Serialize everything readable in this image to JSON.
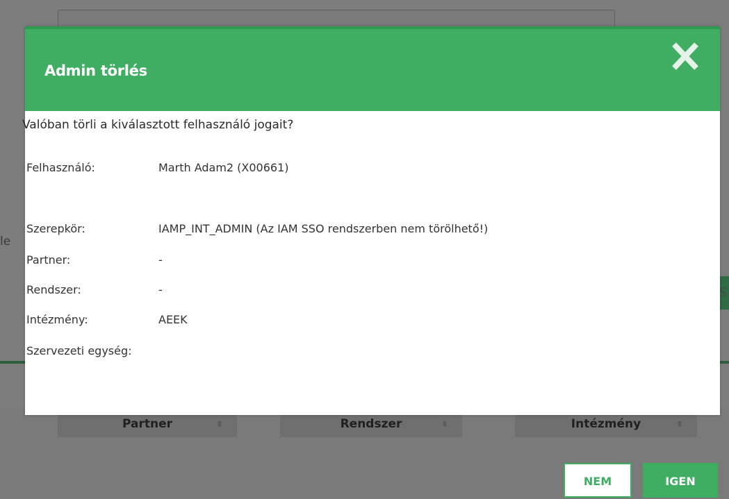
{
  "background": {
    "left_text": "le",
    "right_button_text": "S",
    "table_columns": [
      "Partner",
      "Rendszer",
      "Intézmény"
    ]
  },
  "modal": {
    "title": "Admin törlés",
    "question": "Valóban törli a kiválasztott felhasználó jogait?",
    "fields": [
      {
        "label": "Felhasználó:",
        "value": "Marth Adam2 (X00661)"
      },
      {
        "label": "Szerepkör:",
        "value": "IAMP_INT_ADMIN (Az IAM SSO rendszerben nem törölhető!)"
      },
      {
        "label": "Partner:",
        "value": "-"
      },
      {
        "label": "Rendszer:",
        "value": "-"
      },
      {
        "label": "Intézmény:",
        "value": "AEEK"
      },
      {
        "label": "Szervezeti egység:",
        "value": ""
      }
    ],
    "buttons": {
      "no": "NEM",
      "yes": "IGEN"
    }
  },
  "colors": {
    "accent": "#3fae63",
    "header_border": "#2e9c50",
    "overlay": "#7d7d7d"
  },
  "icons": {
    "close": "close-icon",
    "sort": "sort-icon"
  }
}
